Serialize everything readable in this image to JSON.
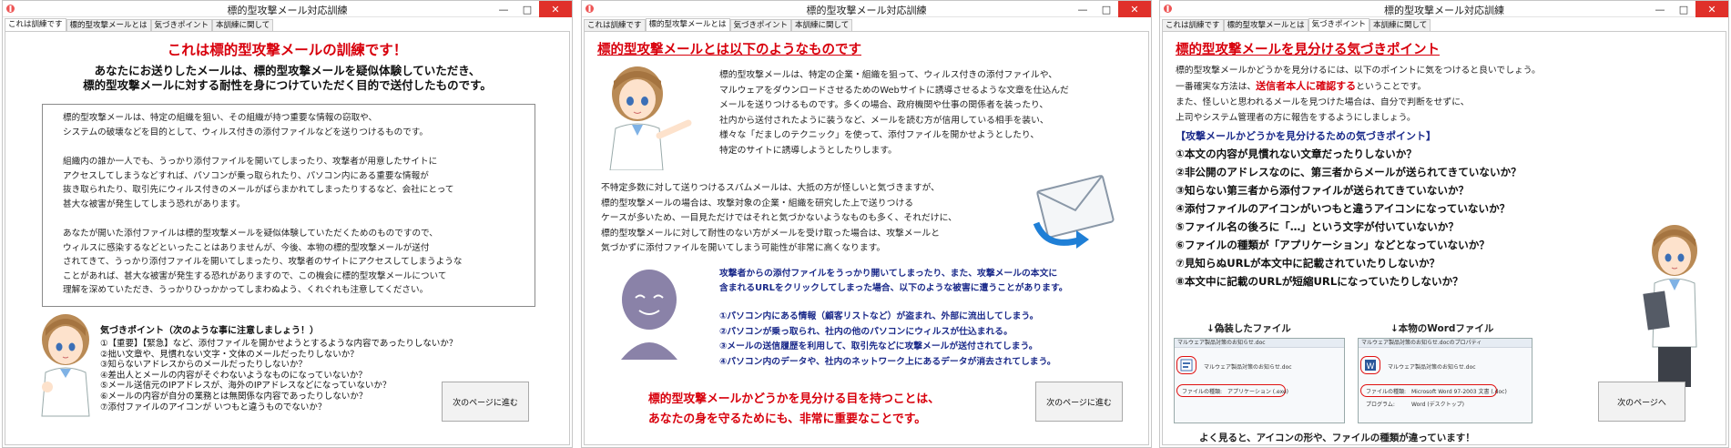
{
  "colors": {
    "accent_red": "#d8000c",
    "navy": "#1b2a8a",
    "close_red": "#e0302a"
  },
  "windows": [
    {
      "title": "標的型攻撃メール対応訓練",
      "tabs": [
        "これは訓練です",
        "標的型攻撃メールとは",
        "気づきポイント",
        "本訓練に関して"
      ],
      "active_tab": 0,
      "heading": "これは標的型攻撃メールの訓練です！",
      "subheading_1": "あなたにお送りしたメールは、標的型攻撃メールを疑似体験していただき、",
      "subheading_2": "標的型攻撃メールに対する耐性を身につけていただく目的で送付したものです。",
      "box_paragraphs": [
        "標的型攻撃メールは、特定の組織を狙い、その組織が持つ重要な情報の窃取や、\nシステムの破壊などを目的として、ウィルス付きの添付ファイルなどを送りつけるものです。",
        "組織内の誰か一人でも、うっかり添付ファイルを開いてしまったり、攻撃者が用意したサイトに\nアクセスしてしまうなどすれば、パソコンが乗っ取られたり、パソコン内にある重要な情報が\n抜き取られたり、取引先にウィルス付きのメールがばらまかれてしまったりするなど、会社にとって\n甚大な被害が発生してしまう恐れがあります。",
        "あなたが開いた添付ファイルは標的型攻撃メールを疑似体験していただくためのものですので、\nウィルスに感染するなどといったことはありませんが、今後、本物の標的型攻撃メールが送付\nされてきて、うっかり添付ファイルを開いてしまったり、攻撃者のサイトにアクセスしてしまうような\nことがあれば、甚大な被害が発生する恐れがありますので、この機会に標的型攻撃メールについて\n理解を深めていただき、うっかりひっかかってしまわぬよう、くれぐれも注意してください。"
      ],
      "tips_title": "気づきポイント（次のような事に注意しましょう！）",
      "tips": [
        "①【重要】【緊急】など、添付ファイルを開かせようとするような内容であったりしないか？",
        "②拙い文章や、見慣れない文字・文体のメールだったりしないか？",
        "③知らないアドレスからのメールだったりしないか？",
        "④差出人とメールの内容がそぐわないようなものになっていないか？",
        "⑤メール送信元のIPアドレスが、海外のIPアドレスなどになっていないか？",
        "⑥メールの内容が自分の業務とは無関係な内容であったりしないか？",
        "⑦添付ファイルのアイコンが いつもと違うものでないか？"
      ],
      "button": "次のページに進む"
    },
    {
      "title": "標的型攻撃メール対応訓練",
      "tabs": [
        "これは訓練です",
        "標的型攻撃メールとは",
        "気づきポイント",
        "本訓練に関して"
      ],
      "active_tab": 1,
      "heading": "標的型攻撃メールとは以下のようなものです",
      "para_1": "標的型攻撃メールは、特定の企業・組織を狙って、ウィルス付きの添付ファイルや、\nマルウェアをダウンロードさせるためのWebサイトに誘導させるような文章を仕込んだ\nメールを送りつけるものです。多くの場合、政府機関や仕事の関係者を装ったり、\n社内から送付されたように装うなど、メールを読む方が信用している相手を装い、\n様々な「だましのテクニック」を使って、添付ファイルを開かせようとしたり、\n特定のサイトに誘導しようとしたりします。",
      "para_2": "不特定多数に対して送りつけるスパムメールは、大抵の方が怪しいと気づきますが、\n標的型攻撃メールの場合は、攻撃対象の企業・組織を研究した上で送りつける\nケースが多いため、一目見ただけではそれと気づかないようなものも多く、それだけに、\n標的型攻撃メールに対して耐性のない方がメールを受け取った場合は、攻撃メールと\n気づかずに添付ファイルを開いてしまう可能性が非常に高くなります。",
      "para_3": "攻撃者からの添付ファイルをうっかり開いてしまったり、また、攻撃メールの本文に\n含まれるURLをクリックしてしまった場合、以下のような被害に遭うことがあります。",
      "damages": [
        "①パソコン内にある情報（顧客リストなど）が盗まれ、外部に流出してしまう。",
        "②パソコンが乗っ取られ、社内の他のパソコンにウィルスが仕込まれる。",
        "③メールの送信履歴を利用して、取引先などに攻撃メールが送付されてしまう。",
        "④パソコン内のデータや、社内のネットワーク上にあるデータが消去されてしまう。"
      ],
      "closing_1": "標的型攻撃メールかどうかを見分ける目を持つことは、",
      "closing_2": "あなたの身を守るためにも、非常に重要なことです。",
      "button": "次のページに進む"
    },
    {
      "title": "標的型攻撃メール対応訓練",
      "tabs": [
        "これは訓練です",
        "標的型攻撃メールとは",
        "気づきポイント",
        "本訓練に関して"
      ],
      "active_tab": 2,
      "heading": "標的型攻撃メールを見分ける気づきポイント",
      "intro_1": "標的型攻撃メールかどうかを見分けるには、以下のポイントに気をつけると良いでしょう。",
      "intro_2_pre": "一番確実な方法は、",
      "intro_2_red": "送信者本人に確認する",
      "intro_2_post": "ということです。",
      "intro_3": "また、怪しいと思われるメールを見つけた場合は、自分で判断をせずに、",
      "intro_4": "上司やシステム管理者の方に報告をするようにしましょう。",
      "points_title": "【攻撃メールかどうかを見分けるための気づきポイント】",
      "points": [
        "①本文の内容が見慣れない文章だったりしないか？",
        "②非公開のアドレスなのに、第三者からメールが送られてきていないか？",
        "③知らない第三者から添付ファイルが送られてきていないか？",
        "④添付ファイルのアイコンがいつもと違うアイコンになっていないか？",
        "⑤ファイル名の後ろに「…」という文字が付いていないか？",
        "⑥ファイルの種類が「アプリケーション」などとなっていないか？",
        "⑦見知らぬURLが本文中に記載されていたりしないか？",
        "⑧本文中に記載のURLが短縮URLになっていたりしないか？"
      ],
      "caption_left": "↓偽装したファイル",
      "caption_right": "↓本物のWordファイル",
      "shot_left": {
        "title": "マルウェア製品対策のお知らせ.doc",
        "file": "マルウェア製品対策のお知らせ.doc",
        "type_label": "ファイルの種類:",
        "type_value": "アプリケーション (.exe)"
      },
      "shot_right": {
        "title": "マルウェア製品対策のお知らせ.docのプロパティ",
        "file": "マルウェア製品対策のお知らせ.doc",
        "type_label": "ファイルの種類:",
        "type_value": "Microsoft Word 97-2003 文書 (.doc)",
        "app_label": "プログラム:",
        "app_value": "Word (デスクトップ)"
      },
      "footer": "よく見ると、アイコンの形や、ファイルの種類が違っています！",
      "button": "次のページへ"
    }
  ]
}
